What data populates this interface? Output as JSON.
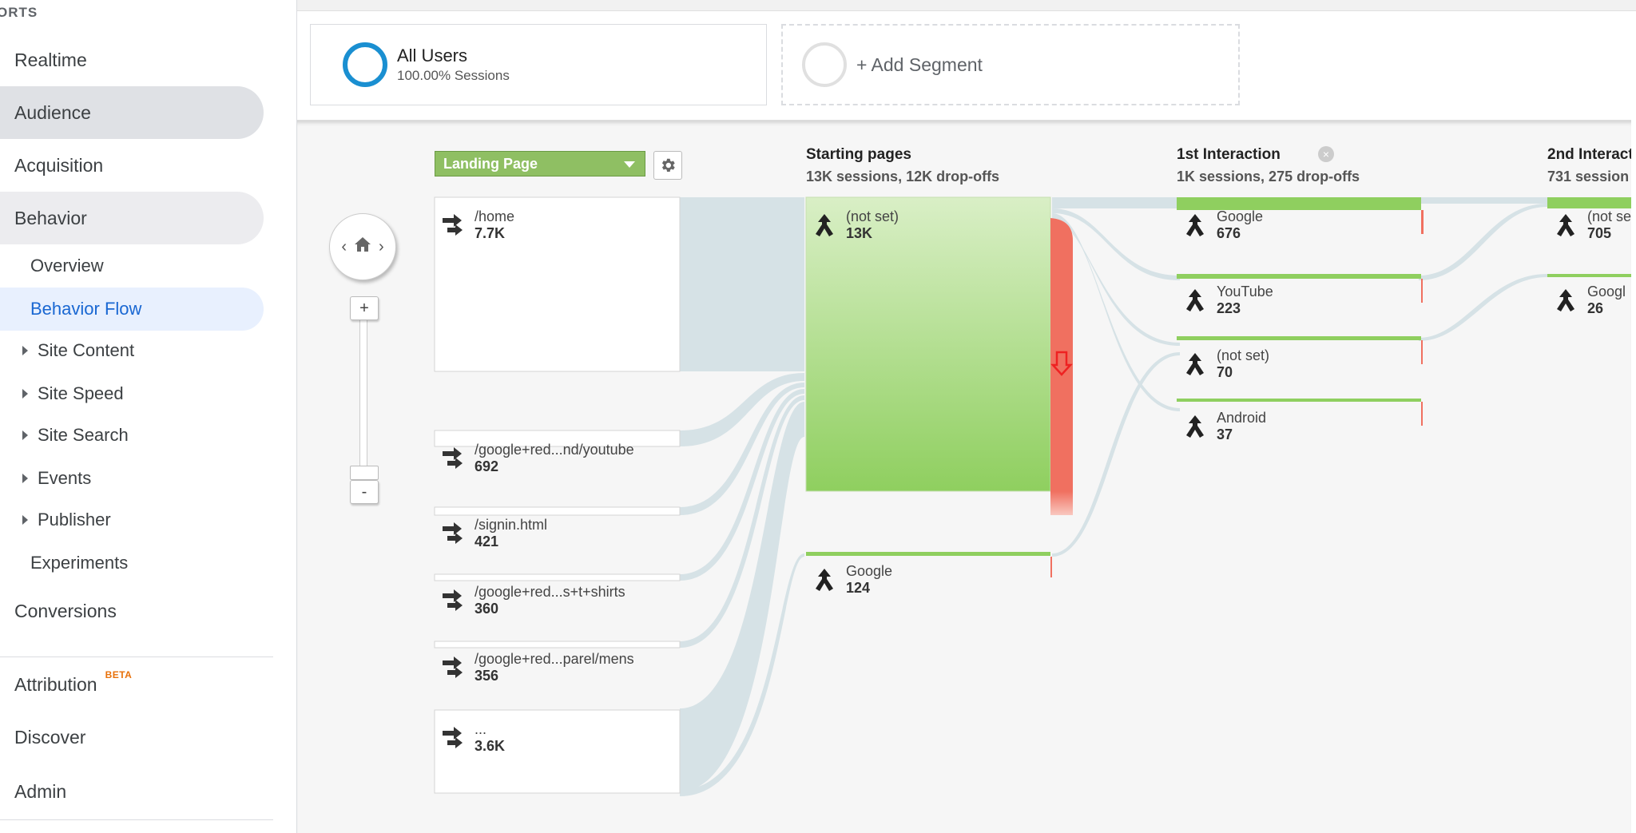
{
  "sidebar": {
    "header": "ORTS",
    "items": [
      {
        "label": "Realtime"
      },
      {
        "label": "Audience"
      },
      {
        "label": "Acquisition"
      },
      {
        "label": "Behavior"
      }
    ],
    "behavior_sub": [
      {
        "label": "Overview"
      },
      {
        "label": "Behavior Flow"
      },
      {
        "label": "Site Content"
      },
      {
        "label": "Site Speed"
      },
      {
        "label": "Site Search"
      },
      {
        "label": "Events"
      },
      {
        "label": "Publisher"
      },
      {
        "label": "Experiments"
      }
    ],
    "conversions": "Conversions",
    "attribution": "Attribution",
    "beta": "BETA",
    "discover": "Discover",
    "admin": "Admin"
  },
  "segments": {
    "all_users_title": "All Users",
    "all_users_sub": "100.00% Sessions",
    "add_segment": "+ Add Segment"
  },
  "flow": {
    "dimension": "Landing Page",
    "landing_pages": [
      {
        "name": "/home",
        "value": "7.7K"
      },
      {
        "name": "/google+red...nd/youtube",
        "value": "692"
      },
      {
        "name": "/signin.html",
        "value": "421"
      },
      {
        "name": "/google+red...s+t+shirts",
        "value": "360"
      },
      {
        "name": "/google+red...parel/mens",
        "value": "356"
      },
      {
        "name": "...",
        "value": "3.6K"
      }
    ],
    "starting": {
      "title": "Starting pages",
      "stats": "13K sessions, 12K drop-offs",
      "nodes": [
        {
          "name": "(not set)",
          "value": "13K"
        },
        {
          "name": "Google",
          "value": "124"
        }
      ]
    },
    "first": {
      "title": "1st Interaction",
      "stats": "1K sessions, 275 drop-offs",
      "nodes": [
        {
          "name": "Google",
          "value": "676"
        },
        {
          "name": "YouTube",
          "value": "223"
        },
        {
          "name": "(not set)",
          "value": "70"
        },
        {
          "name": "Android",
          "value": "37"
        }
      ]
    },
    "second": {
      "title": "2nd Interact",
      "stats": "731 session",
      "nodes": [
        {
          "name": "(not se",
          "value": "705"
        },
        {
          "name": "Googl",
          "value": "26"
        }
      ]
    }
  },
  "colors": {
    "accent": "#1967d2",
    "node_green": "#8fcf5f",
    "dropoff_red": "#f07060",
    "flow_grey": "#d6e2e6"
  }
}
